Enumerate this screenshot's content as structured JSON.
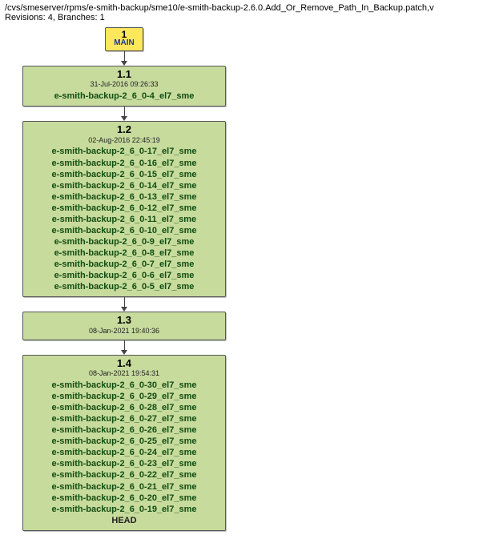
{
  "header": {
    "path": "/cvs/smeserver/rpms/e-smith-backup/sme10/e-smith-backup-2.6.0.Add_Or_Remove_Path_In_Backup.patch,v",
    "meta": "Revisions: 4, Branches: 1"
  },
  "branch": {
    "number": "1",
    "name": "MAIN"
  },
  "revisions": [
    {
      "number": "1.1",
      "date": "31-Jul-2016 09:26:33",
      "tags": [
        "e-smith-backup-2_6_0-4_el7_sme"
      ],
      "head": null
    },
    {
      "number": "1.2",
      "date": "02-Aug-2016 22:45:19",
      "tags": [
        "e-smith-backup-2_6_0-17_el7_sme",
        "e-smith-backup-2_6_0-16_el7_sme",
        "e-smith-backup-2_6_0-15_el7_sme",
        "e-smith-backup-2_6_0-14_el7_sme",
        "e-smith-backup-2_6_0-13_el7_sme",
        "e-smith-backup-2_6_0-12_el7_sme",
        "e-smith-backup-2_6_0-11_el7_sme",
        "e-smith-backup-2_6_0-10_el7_sme",
        "e-smith-backup-2_6_0-9_el7_sme",
        "e-smith-backup-2_6_0-8_el7_sme",
        "e-smith-backup-2_6_0-7_el7_sme",
        "e-smith-backup-2_6_0-6_el7_sme",
        "e-smith-backup-2_6_0-5_el7_sme"
      ],
      "head": null
    },
    {
      "number": "1.3",
      "date": "08-Jan-2021 19:40:36",
      "tags": [],
      "head": null
    },
    {
      "number": "1.4",
      "date": "08-Jan-2021 19:54:31",
      "tags": [
        "e-smith-backup-2_6_0-30_el7_sme",
        "e-smith-backup-2_6_0-29_el7_sme",
        "e-smith-backup-2_6_0-28_el7_sme",
        "e-smith-backup-2_6_0-27_el7_sme",
        "e-smith-backup-2_6_0-26_el7_sme",
        "e-smith-backup-2_6_0-25_el7_sme",
        "e-smith-backup-2_6_0-24_el7_sme",
        "e-smith-backup-2_6_0-23_el7_sme",
        "e-smith-backup-2_6_0-22_el7_sme",
        "e-smith-backup-2_6_0-21_el7_sme",
        "e-smith-backup-2_6_0-20_el7_sme",
        "e-smith-backup-2_6_0-19_el7_sme"
      ],
      "head": "HEAD"
    }
  ]
}
